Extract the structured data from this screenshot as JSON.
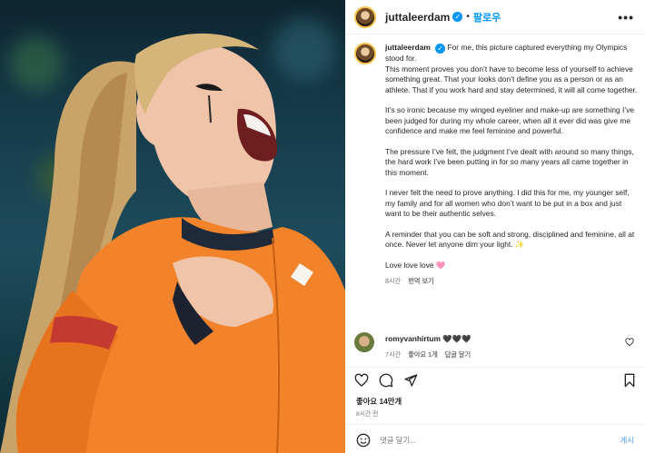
{
  "post": {
    "username": "juttaleerdam",
    "verified_glyph": "✓",
    "dot": "•",
    "follow_label": "팔로우",
    "more_icon": "more-horizontal-icon"
  },
  "caption": {
    "username": "juttaleerdam",
    "p1_lead": "For me, this picture captured everything my Olympics stood for.",
    "p1_rest": "This moment proves you don’t have to become less of yourself to achieve something great. That your looks don’t define you as a person or as an athlete. That if you work hard and stay determined, it will all come together.",
    "p2": "It’s so ironic because my winged eyeliner and make-up are something I’ve been judged for during my whole career, when all it ever did was give me confidence and make me feel feminine and powerful.",
    "p3": "The pressure I’ve felt, the judgment I’ve dealt with around so many things, the hard work I’ve been putting in for so many years all came together in this moment.",
    "p4": "I never felt the need to prove anything. I did this for me, my younger self, my family and for all women who don’t want to be put in a box and just want to be their authentic selves.",
    "p5": "A reminder that you can be soft and strong, disciplined and feminine, all at once. Never let anyone dim your light. ✨",
    "p6": "Love love love 🩷",
    "time": "8시간",
    "translate_label": "번역 보기"
  },
  "comment": {
    "username": "romyvanhirtum",
    "text": "🖤🖤🖤",
    "time": "7시간",
    "likes": "좋아요 1개",
    "reply_label": "답글 달기"
  },
  "footer": {
    "likes": "좋아요 14만개",
    "time_ago": "8시간 전",
    "comment_placeholder": "댓글 달기...",
    "post_label": "게시"
  },
  "icons": [
    "heart-icon",
    "comment-icon",
    "share-icon",
    "bookmark-icon",
    "emoji-icon",
    "more-horizontal-icon"
  ],
  "colors": {
    "accent": "#0095f6",
    "suit_orange": "#f2832a",
    "text": "#262626",
    "muted": "#737373"
  }
}
